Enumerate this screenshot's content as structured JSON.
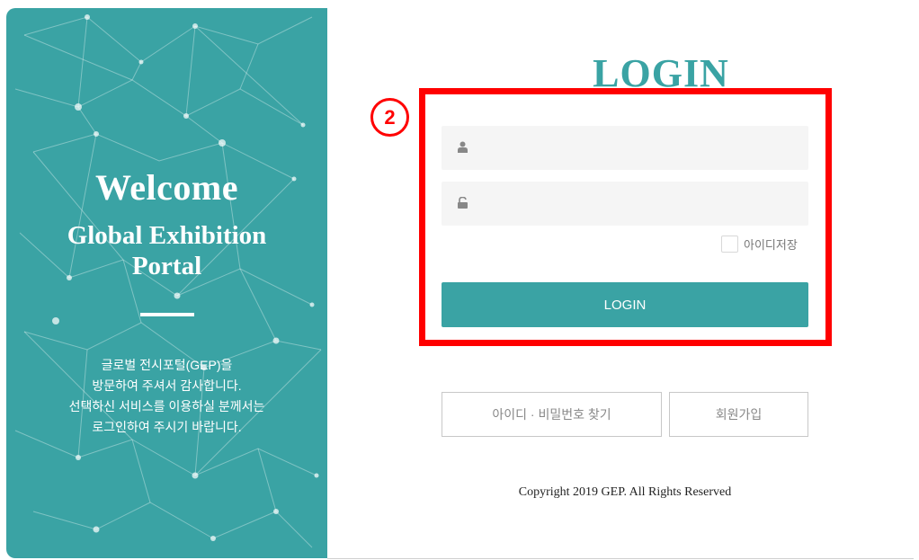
{
  "left_panel": {
    "welcome": "Welcome",
    "portal_line1": "Global Exhibition",
    "portal_line2": "Portal",
    "intro_lines": [
      "글로벌 전시포털(GEP)을",
      "방문하여 주셔서 감사합니다.",
      "선택하신 서비스를 이용하실 분께서는",
      "로그인하여 주시기 바랍니다."
    ]
  },
  "login": {
    "title": "LOGIN",
    "username_value": "",
    "password_value": "",
    "remember_label": "아이디저장",
    "remember_checked": false,
    "button_label": "LOGIN"
  },
  "annotation": {
    "step_number": "2",
    "color": "#ff0000"
  },
  "links": {
    "find_id_pw": "아이디 · 비밀번호 찾기",
    "signup": "회원가입"
  },
  "footer": {
    "copyright": "Copyright 2019 GEP. All Rights Reserved"
  },
  "colors": {
    "brand": "#3aa3a4",
    "input_bg": "#f5f5f5"
  },
  "icons": {
    "username": "user-icon",
    "password": "unlock-icon"
  }
}
